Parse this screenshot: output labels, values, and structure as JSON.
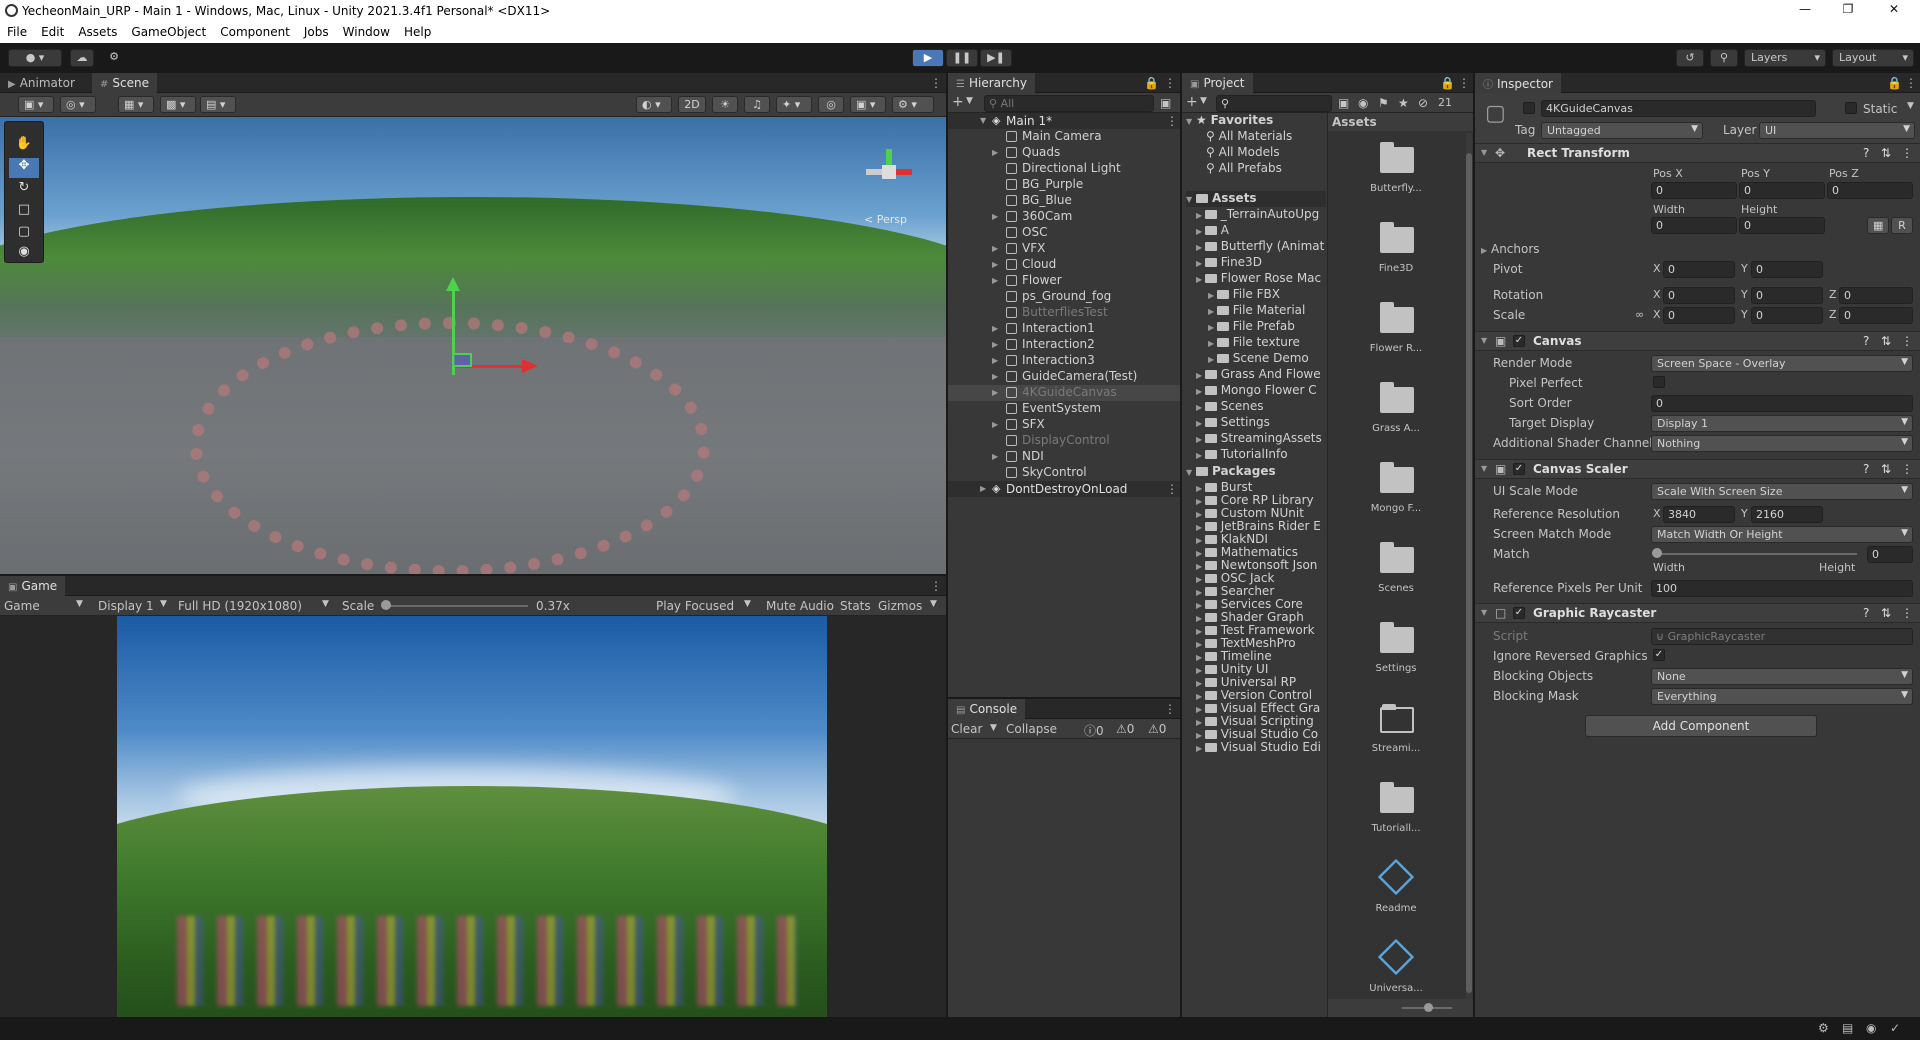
{
  "window": {
    "title": "YecheonMain_URP - Main 1 - Windows, Mac, Linux - Unity 2021.3.4f1 Personal* <DX11>"
  },
  "menu": [
    "File",
    "Edit",
    "Assets",
    "GameObject",
    "Component",
    "Jobs",
    "Window",
    "Help"
  ],
  "toolbar": {
    "layers": "Layers",
    "layout": "Layout"
  },
  "scene_panel": {
    "tabs": [
      "Animator",
      "Scene"
    ],
    "btn_2d": "2D",
    "persp": "< Persp"
  },
  "game_panel": {
    "tab": "Game",
    "view_dropdown": "Game",
    "display": "Display 1",
    "resolution": "Full HD (1920x1080)",
    "scale_label": "Scale",
    "scale_value": "0.37x",
    "play_mode": "Play Focused",
    "mute": "Mute Audio",
    "stats": "Stats",
    "gizmos": "Gizmos"
  },
  "hierarchy": {
    "tab": "Hierarchy",
    "search_placeholder": "All",
    "scene_root": "Main 1*",
    "items": [
      {
        "name": "Main Camera",
        "expandable": false,
        "dim": false
      },
      {
        "name": "Quads",
        "expandable": true,
        "dim": false
      },
      {
        "name": "Directional Light",
        "expandable": false,
        "dim": false
      },
      {
        "name": "BG_Purple",
        "expandable": false,
        "dim": false
      },
      {
        "name": "BG_Blue",
        "expandable": false,
        "dim": false
      },
      {
        "name": "360Cam",
        "expandable": true,
        "dim": false
      },
      {
        "name": "OSC",
        "expandable": false,
        "dim": false
      },
      {
        "name": "VFX",
        "expandable": true,
        "dim": false
      },
      {
        "name": "Cloud",
        "expandable": true,
        "dim": false
      },
      {
        "name": "Flower",
        "expandable": true,
        "dim": false
      },
      {
        "name": "ps_Ground_fog",
        "expandable": false,
        "dim": false
      },
      {
        "name": "ButterfliesTest",
        "expandable": false,
        "dim": true
      },
      {
        "name": "Interaction1",
        "expandable": true,
        "dim": false
      },
      {
        "name": "Interaction2",
        "expandable": true,
        "dim": false
      },
      {
        "name": "Interaction3",
        "expandable": true,
        "dim": false
      },
      {
        "name": "GuideCamera(Test)",
        "expandable": true,
        "dim": false
      },
      {
        "name": "4KGuideCanvas",
        "expandable": true,
        "dim": true,
        "selected": true
      },
      {
        "name": "EventSystem",
        "expandable": false,
        "dim": false
      },
      {
        "name": "SFX",
        "expandable": true,
        "dim": false
      },
      {
        "name": "DisplayControl",
        "expandable": false,
        "dim": true
      },
      {
        "name": "NDI",
        "expandable": true,
        "dim": false
      },
      {
        "name": "SkyControl",
        "expandable": false,
        "dim": false
      }
    ],
    "dont_destroy": "DontDestroyOnLoad"
  },
  "console": {
    "tab": "Console",
    "clear": "Clear",
    "collapse": "Collapse",
    "counts": [
      "0",
      "0",
      "0"
    ]
  },
  "project": {
    "tab": "Project",
    "count": "21",
    "favorites_label": "Favorites",
    "favorites": [
      "All Materials",
      "All Models",
      "All Prefabs"
    ],
    "assets_label": "Assets",
    "assets": [
      {
        "name": "_TerrainAutoUpg",
        "indent": 1
      },
      {
        "name": "A",
        "indent": 1
      },
      {
        "name": "Butterfly (Animat",
        "indent": 1
      },
      {
        "name": "Fine3D",
        "indent": 1
      },
      {
        "name": "Flower Rose Mac",
        "indent": 1
      },
      {
        "name": "File FBX",
        "indent": 2
      },
      {
        "name": "File Material",
        "indent": 2
      },
      {
        "name": "File Prefab",
        "indent": 2
      },
      {
        "name": "File texture",
        "indent": 2
      },
      {
        "name": "Scene Demo",
        "indent": 2
      },
      {
        "name": "Grass And Flowe",
        "indent": 1
      },
      {
        "name": "Mongo Flower C",
        "indent": 1
      },
      {
        "name": "Scenes",
        "indent": 1
      },
      {
        "name": "Settings",
        "indent": 1
      },
      {
        "name": "StreamingAssets",
        "indent": 1
      },
      {
        "name": "TutorialInfo",
        "indent": 1
      }
    ],
    "packages_label": "Packages",
    "packages": [
      "Burst",
      "Core RP Library",
      "Custom NUnit",
      "JetBrains Rider E",
      "KlakNDI",
      "Mathematics",
      "Newtonsoft Json",
      "OSC Jack",
      "Searcher",
      "Services Core",
      "Shader Graph",
      "Test Framework",
      "TextMeshPro",
      "Timeline",
      "Unity UI",
      "Universal RP",
      "Version Control",
      "Visual Effect Gra",
      "Visual Scripting",
      "Visual Studio Co",
      "Visual Studio Edi"
    ],
    "grid_header": "Assets",
    "grid_items": [
      "Butterfly...",
      "Fine3D",
      "Flower R...",
      "Grass A...",
      "Mongo F...",
      "Scenes",
      "Settings",
      "Streami...",
      "Tutoriall...",
      "Readme",
      "Universa..."
    ]
  },
  "inspector": {
    "tab": "Inspector",
    "object_name": "4KGuideCanvas",
    "static": "Static",
    "tag_label": "Tag",
    "tag": "Untagged",
    "layer_label": "Layer",
    "layer": "UI",
    "rect_transform": {
      "header": "Rect Transform",
      "posx_label": "Pos X",
      "posy_label": "Pos Y",
      "posz_label": "Pos Z",
      "posx": "0",
      "posy": "0",
      "posz": "0",
      "width_label": "Width",
      "height_label": "Height",
      "width": "0",
      "height": "0",
      "anchors": "Anchors",
      "pivot": "Pivot",
      "pivot_x": "0",
      "pivot_y": "0",
      "rotation": "Rotation",
      "rot_x": "0",
      "rot_y": "0",
      "rot_z": "0",
      "scale": "Scale",
      "scale_x": "0",
      "scale_y": "0",
      "scale_z": "0",
      "r_btn": "R"
    },
    "canvas": {
      "header": "Canvas",
      "render_mode_label": "Render Mode",
      "render_mode": "Screen Space - Overlay",
      "pixel_perfect": "Pixel Perfect",
      "sort_order_label": "Sort Order",
      "sort_order": "0",
      "target_display_label": "Target Display",
      "target_display": "Display 1",
      "shader_channels_label": "Additional Shader Channels",
      "shader_channels": "Nothing"
    },
    "canvas_scaler": {
      "header": "Canvas Scaler",
      "ui_scale_mode_label": "UI Scale Mode",
      "ui_scale_mode": "Scale With Screen Size",
      "ref_res_label": "Reference Resolution",
      "ref_x": "3840",
      "ref_y": "2160",
      "match_mode_label": "Screen Match Mode",
      "match_mode": "Match Width Or Height",
      "match_label": "Match",
      "match_value": "0",
      "match_width": "Width",
      "match_height": "Height",
      "ppu_label": "Reference Pixels Per Unit",
      "ppu": "100"
    },
    "graphic_raycaster": {
      "header": "Graphic Raycaster",
      "script_label": "Script",
      "script": "GraphicRaycaster",
      "ignore_reversed": "Ignore Reversed Graphics",
      "blocking_objects_label": "Blocking Objects",
      "blocking_objects": "None",
      "blocking_mask_label": "Blocking Mask",
      "blocking_mask": "Everything"
    },
    "add_component": "Add Component"
  },
  "colors": {
    "accent": "#4a78b5",
    "selection": "#2c5d87",
    "panel": "#383838"
  }
}
